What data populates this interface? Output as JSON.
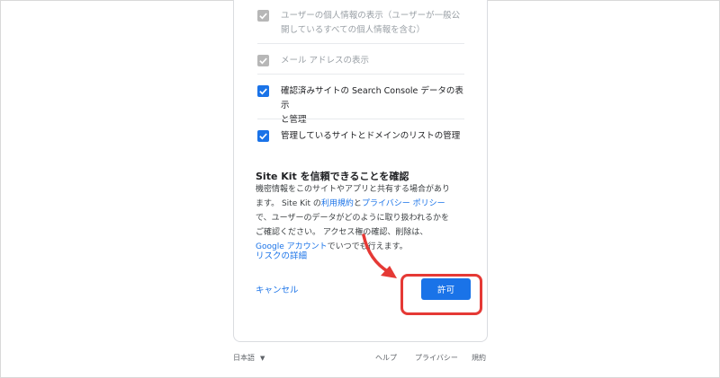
{
  "permissions": [
    {
      "line1": "ユーザーの個人情報の表示（ユーザーが一般公",
      "line2": "開しているすべての個人情報を含む）",
      "checked": true,
      "disabled": true
    },
    {
      "line1": "メール アドレスの表示",
      "line2": "",
      "checked": true,
      "disabled": true
    },
    {
      "line1": "確認済みサイトの Search Console データの表示",
      "line2": "と管理",
      "checked": true,
      "disabled": false
    },
    {
      "line1": "管理しているサイトとドメインのリストの管理",
      "line2": "",
      "checked": true,
      "disabled": false
    }
  ],
  "confirm": {
    "title": "Site Kit を信頼できることを確認",
    "p1": "機密情報をこのサイトやアプリと共有する場合があり",
    "p2a": "ます。 Site Kit の",
    "terms_link": "利用規約",
    "p2b": "と",
    "privacy_link": "プライバシー ポリシー",
    "p3": "で、ユーザーのデータがどのように取り扱われるかを",
    "p4": "ご確認ください。 アクセス権の確認、削除は、",
    "account_link": "Google アカウント",
    "p5": "でいつでも行えます。"
  },
  "risk_link": "リスクの詳細",
  "cancel_label": "キャンセル",
  "allow_label": "許可",
  "footer": {
    "language": "日本語",
    "help": "ヘルプ",
    "privacy": "プライバシー",
    "terms": "規約"
  },
  "colors": {
    "accent": "#1a73e8",
    "annotation": "#e53935",
    "disabled_check": "#b7b7b7"
  }
}
